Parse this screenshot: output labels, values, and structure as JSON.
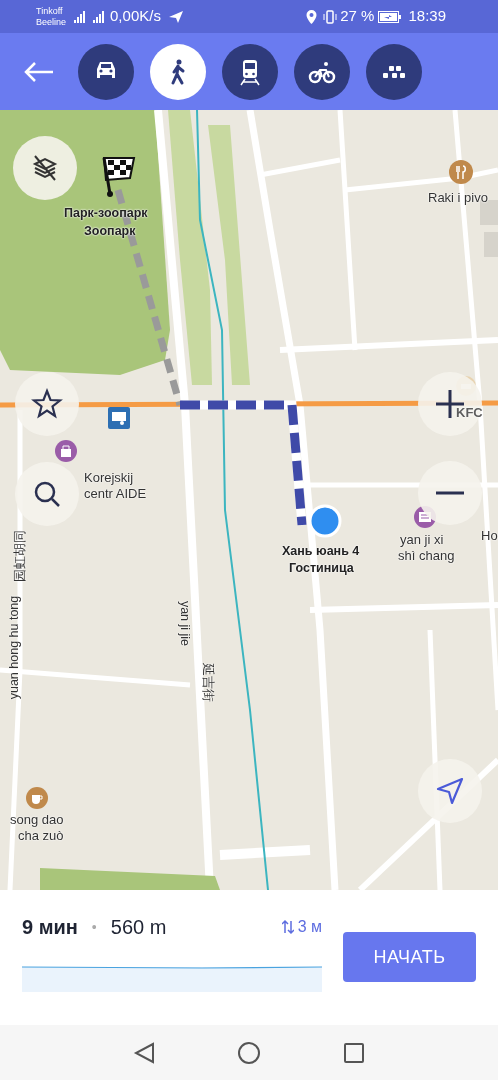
{
  "status_bar": {
    "carrier_1": "Tinkoff",
    "carrier_2": "Beeline",
    "network_speed": "0,00K/s",
    "battery": "27 %",
    "time": "18:39"
  },
  "transport_modes": [
    {
      "kind": "car",
      "selected": false
    },
    {
      "kind": "walk",
      "selected": true
    },
    {
      "kind": "train",
      "selected": false
    },
    {
      "kind": "bike",
      "selected": false
    },
    {
      "kind": "taxi",
      "selected": false
    }
  ],
  "map": {
    "labels": [
      {
        "kind": "place",
        "text": "Парк-зоопарк"
      },
      {
        "kind": "place",
        "text": "Зоопарк"
      },
      {
        "kind": "poi",
        "text": "Raki i pivo"
      },
      {
        "kind": "faded",
        "text": "KFC"
      },
      {
        "kind": "poi",
        "text": "Korejskij"
      },
      {
        "kind": "poi",
        "text": "centr AIDE"
      },
      {
        "kind": "place",
        "text": "Хань юань 4"
      },
      {
        "kind": "place",
        "text": "Гостиница"
      },
      {
        "kind": "poi",
        "text": "yan ji xi"
      },
      {
        "kind": "poi",
        "text": "shì chang"
      },
      {
        "kind": "poi",
        "text": "Ho"
      },
      {
        "kind": "street-down",
        "text": "yan ji jie"
      },
      {
        "kind": "street-down",
        "text": "延吉街"
      },
      {
        "kind": "street-up",
        "text": "yuan hong hu tong"
      },
      {
        "kind": "street-up",
        "text": "园虹胡同"
      },
      {
        "kind": "poi",
        "text": "song dao"
      },
      {
        "kind": "poi",
        "text": "cha zuò"
      }
    ]
  },
  "route_summary": {
    "duration": "9 мин",
    "separator": "•",
    "distance": "560 m",
    "elevation": "3 м",
    "start_button": "НАЧАТЬ"
  }
}
